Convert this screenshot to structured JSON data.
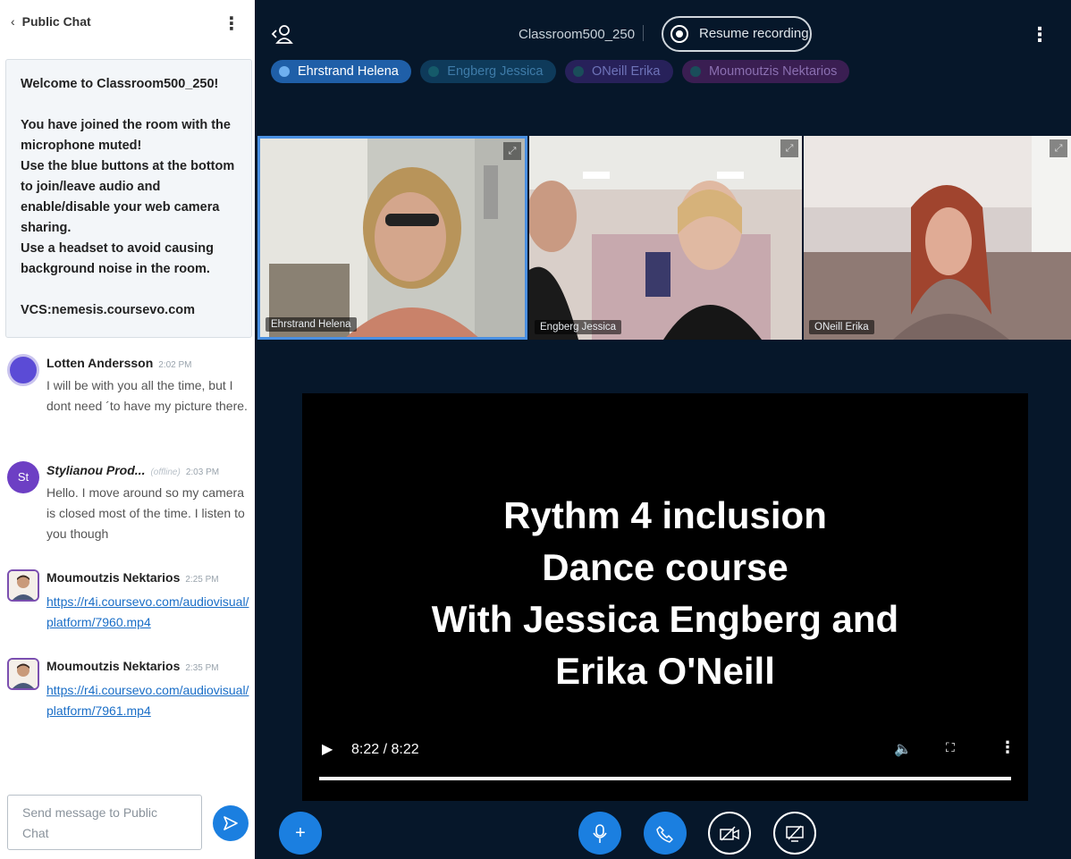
{
  "chat": {
    "title": "Public Chat",
    "welcome": {
      "line1_prefix": "Welcome to ",
      "line1_room": "Classroom500_250",
      "line1_suffix": "!",
      "para2": "You have joined the room with the microphone muted!",
      "para3": "Use the blue buttons at the bottom to join/leave audio and enable/disable your web camera sharing.",
      "para4": "Use a headset to avoid causing background noise in the room.",
      "vcs": "VCS:nemesis.coursevo.com"
    },
    "messages": [
      {
        "name": "Lotten Andersson",
        "time": "2:02 PM",
        "text": "I will be with you all the time, but I dont need ´to have my picture there.",
        "avatar_color": "#5b4bd6"
      },
      {
        "name": "Stylianou Prod...",
        "status": "(offline)",
        "time": "2:03 PM",
        "text": "Hello. I move around so my camera is closed most of the time. I listen to you though",
        "avatar_initials": "St",
        "avatar_color": "#6d3fc4"
      },
      {
        "name": "Moumoutzis Nektarios",
        "time": "2:25 PM",
        "link": "https://r4i.coursevo.com/audiovisual/platform/7960.mp4"
      },
      {
        "name": "Moumoutzis Nektarios",
        "time": "2:35 PM",
        "link": "https://r4i.coursevo.com/audiovisual/platform/7961.mp4"
      }
    ],
    "composer_placeholder": "Send message to Public Chat"
  },
  "room": {
    "title": "Classroom500_250",
    "recording_label": "Resume recording"
  },
  "talkers": [
    {
      "name": "Ehrstrand Helena",
      "active": true
    },
    {
      "name": "Engberg Jessica",
      "active": false
    },
    {
      "name": "ONeill Erika",
      "active": false
    },
    {
      "name": "Moumoutzis Nektarios",
      "active": false
    }
  ],
  "tiles": [
    {
      "name": "Ehrstrand Helena",
      "speaking": true
    },
    {
      "name": "Engberg Jessica",
      "speaking": false
    },
    {
      "name": "ONeill Erika",
      "speaking": false
    }
  ],
  "video": {
    "title_lines": [
      "Rythm 4 inclusion",
      "Dance course",
      "With Jessica Engberg and",
      "Erika O'Neill"
    ],
    "time": "8:22 / 8:22",
    "progress": 1.0
  },
  "colors": {
    "accent": "#1b7fe0",
    "background": "#06172a",
    "speaking_border": "#4a90e2"
  }
}
